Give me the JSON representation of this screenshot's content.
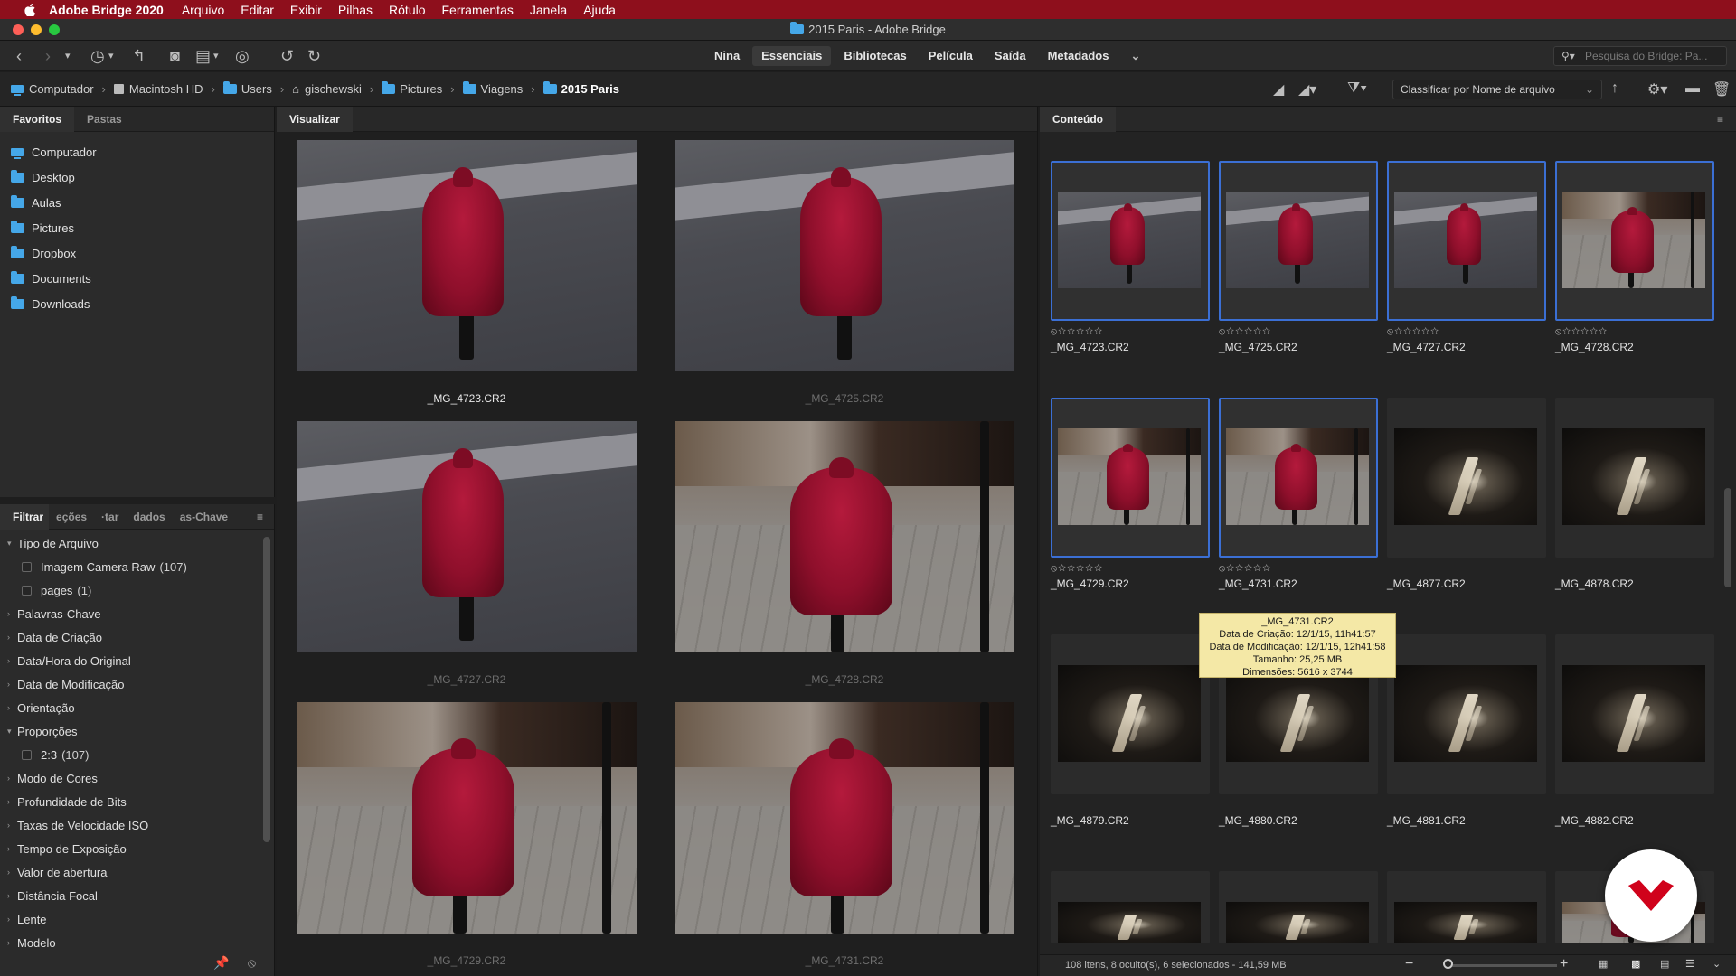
{
  "menubar": {
    "app": "Adobe Bridge 2020",
    "items": [
      "Arquivo",
      "Editar",
      "Exibir",
      "Pilhas",
      "Rótulo",
      "Ferramentas",
      "Janela",
      "Ajuda"
    ]
  },
  "window": {
    "title": "2015 Paris - Adobe Bridge"
  },
  "toolbar": {
    "workspaces": [
      "Nina",
      "Essenciais",
      "Bibliotecas",
      "Película",
      "Saída",
      "Metadados"
    ],
    "active_workspace": "Essenciais",
    "search_placeholder": "Pesquisa do Bridge: Pa..."
  },
  "breadcrumbs": [
    "Computador",
    "Macintosh HD",
    "Users",
    "gischewski",
    "Pictures",
    "Viagens",
    "2015 Paris"
  ],
  "sort": {
    "label": "Classificar por Nome de arquivo"
  },
  "left_panel": {
    "tabs": [
      "Favoritos",
      "Pastas"
    ],
    "favorites": [
      "Computador",
      "Desktop",
      "Aulas",
      "Pictures",
      "Dropbox",
      "Documents",
      "Downloads"
    ]
  },
  "filter_panel": {
    "tabs": [
      "Filtrar",
      "eções",
      "·tar",
      "dados",
      "as-Chave"
    ],
    "items": [
      {
        "label": "Tipo de Arquivo",
        "expanded": true
      },
      {
        "label": "Imagem Camera Raw",
        "count": "(107)",
        "sub": true
      },
      {
        "label": "pages",
        "count": "(1)",
        "sub": true
      },
      {
        "label": "Palavras-Chave"
      },
      {
        "label": "Data de Criação"
      },
      {
        "label": "Data/Hora do Original"
      },
      {
        "label": "Data de Modificação"
      },
      {
        "label": "Orientação"
      },
      {
        "label": "Proporções",
        "expanded": true
      },
      {
        "label": "2:3",
        "count": "(107)",
        "sub": true
      },
      {
        "label": "Modo de Cores"
      },
      {
        "label": "Profundidade de Bits"
      },
      {
        "label": "Taxas de Velocidade ISO"
      },
      {
        "label": "Tempo de Exposição"
      },
      {
        "label": "Valor de abertura"
      },
      {
        "label": "Distância Focal"
      },
      {
        "label": "Lente"
      },
      {
        "label": "Modelo"
      }
    ]
  },
  "preview": {
    "tab": "Visualizar",
    "items": [
      {
        "name": "_MG_4723.CR2",
        "selected": true
      },
      {
        "name": "_MG_4725.CR2",
        "selected": false
      },
      {
        "name": "_MG_4727.CR2",
        "selected": false
      },
      {
        "name": "_MG_4728.CR2",
        "selected": false
      },
      {
        "name": "_MG_4729.CR2",
        "selected": false
      },
      {
        "name": "_MG_4731.CR2",
        "selected": false
      }
    ]
  },
  "content": {
    "tab": "Conteúdo",
    "items": [
      {
        "name": "_MG_4723.CR2",
        "selected": true,
        "kind": "street"
      },
      {
        "name": "_MG_4725.CR2",
        "selected": true,
        "kind": "street"
      },
      {
        "name": "_MG_4727.CR2",
        "selected": true,
        "kind": "street"
      },
      {
        "name": "_MG_4728.CR2",
        "selected": true,
        "kind": "wall"
      },
      {
        "name": "_MG_4729.CR2",
        "selected": true,
        "kind": "wall"
      },
      {
        "name": "_MG_4731.CR2",
        "selected": true,
        "kind": "wall"
      },
      {
        "name": "_MG_4877.CR2",
        "selected": false,
        "kind": "dark"
      },
      {
        "name": "_MG_4878.CR2",
        "selected": false,
        "kind": "dark"
      },
      {
        "name": "_MG_4879.CR2",
        "selected": false,
        "kind": "dark"
      },
      {
        "name": "_MG_4880.CR2",
        "selected": false,
        "kind": "dark"
      },
      {
        "name": "_MG_4881.CR2",
        "selected": false,
        "kind": "dark"
      },
      {
        "name": "_MG_4882.CR2",
        "selected": false,
        "kind": "dark"
      }
    ],
    "rating_glyphs": "⦸☆☆☆☆☆"
  },
  "tooltip": {
    "lines": [
      "_MG_4731.CR2",
      "Data de Criação: 12/1/15, 11h41:57",
      "Data de Modificação: 12/1/15, 12h41:58",
      "Tamanho: 25,25 MB",
      "Dimensões: 5616 x 3744"
    ]
  },
  "status": {
    "text": "108 itens, 8 oculto(s), 6 selecionados - 141,59 MB"
  },
  "colors": {
    "menubar": "#8e0f1c",
    "selection": "#3b6fd4",
    "folder": "#45a7e8",
    "coat": "#8e0f2b",
    "badge_mark": "#d0021b"
  }
}
